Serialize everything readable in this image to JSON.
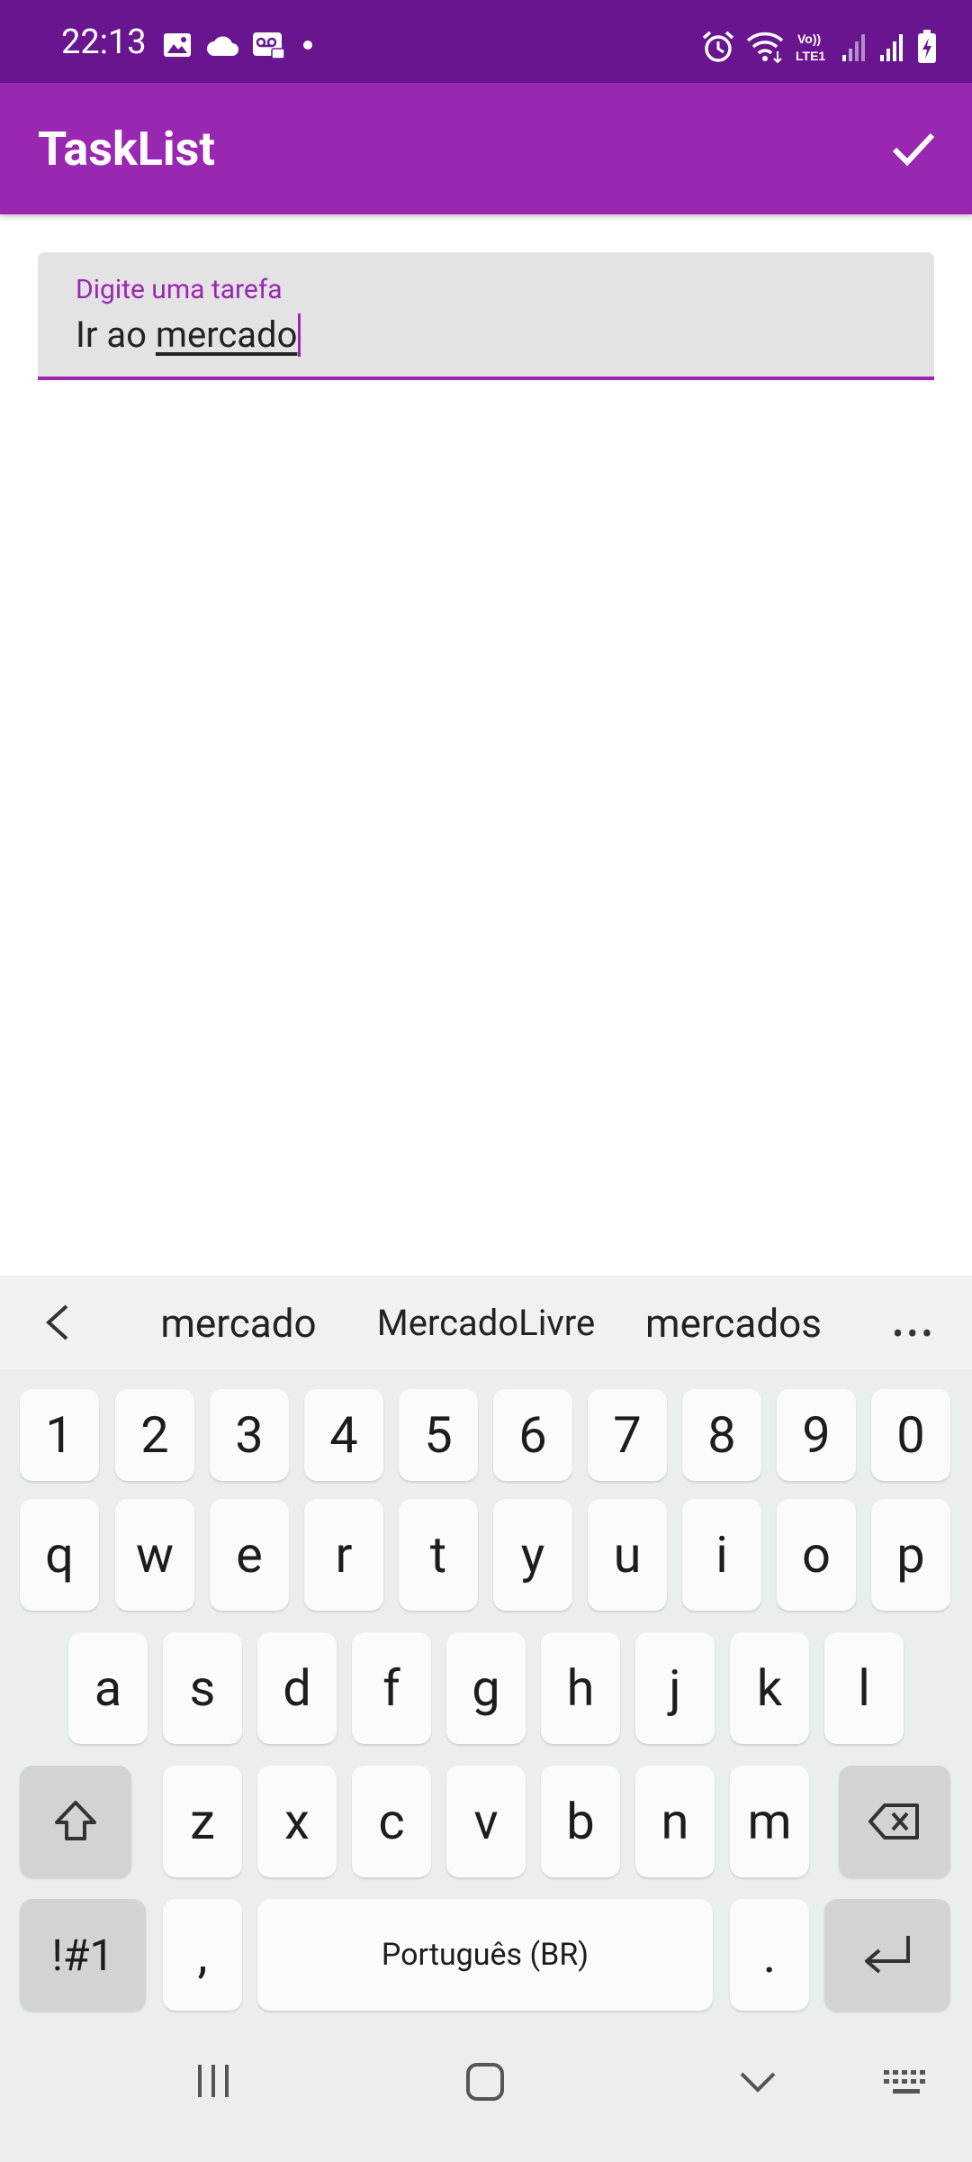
{
  "status": {
    "time": "22:13"
  },
  "app": {
    "title": "TaskList"
  },
  "input": {
    "label": "Digite uma tarefa",
    "value_plain": "Ir ao ",
    "value_underlined": "mercado"
  },
  "suggestions": [
    "mercado",
    "MercadoLivre",
    "mercados"
  ],
  "keyboard": {
    "row_numbers": [
      "1",
      "2",
      "3",
      "4",
      "5",
      "6",
      "7",
      "8",
      "9",
      "0"
    ],
    "row1": [
      "q",
      "w",
      "e",
      "r",
      "t",
      "y",
      "u",
      "i",
      "o",
      "p"
    ],
    "row2": [
      "a",
      "s",
      "d",
      "f",
      "g",
      "h",
      "j",
      "k",
      "l"
    ],
    "row3": [
      "z",
      "x",
      "c",
      "v",
      "b",
      "n",
      "m"
    ],
    "symbols": "!#1",
    "comma": ",",
    "space": "Português (BR)",
    "period": "."
  }
}
